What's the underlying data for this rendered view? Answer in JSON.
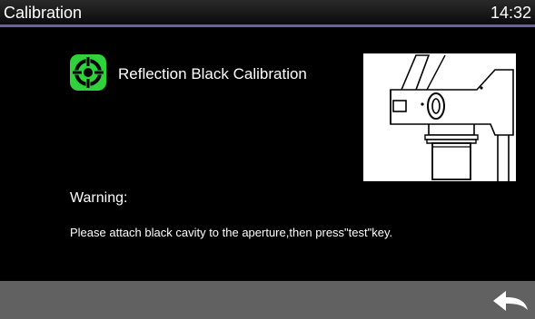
{
  "titlebar": {
    "title": "Calibration",
    "time": "14:32"
  },
  "main": {
    "icon": "calibration-target-icon",
    "heading": "Reflection Black Calibration",
    "illustration": "instrument-aperture-illustration",
    "warning_label": "Warning:",
    "warning_message": "Please attach black cavity to the aperture,then press\"test\"key."
  },
  "footer": {
    "back_icon": "back-arrow-icon"
  },
  "colors": {
    "titlebar_accent": "#6a5fa0",
    "icon_green": "#2fd23a",
    "footer_bg": "#616161"
  }
}
